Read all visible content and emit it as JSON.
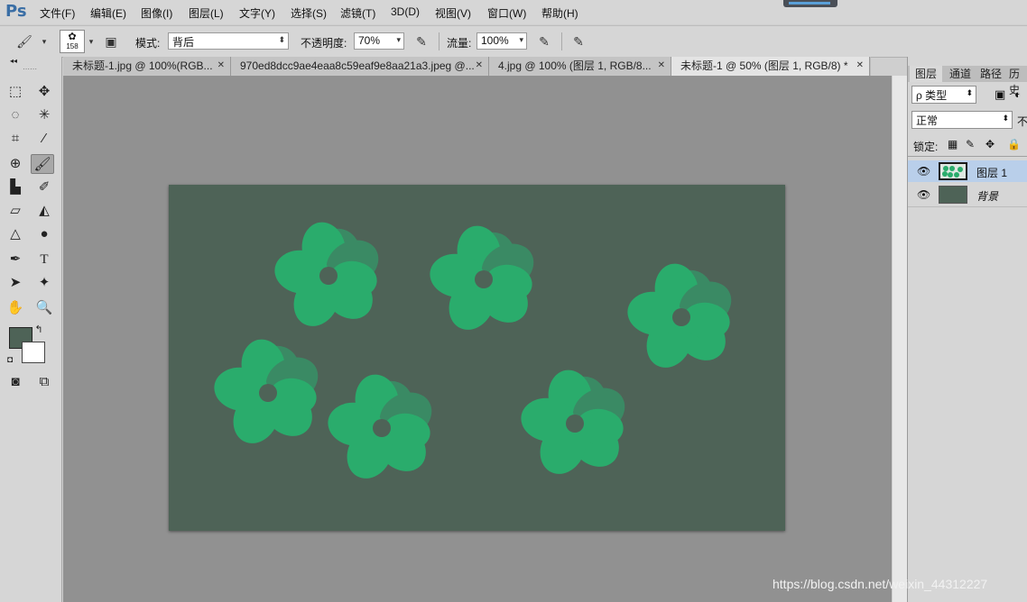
{
  "app": {
    "logo": "Ps",
    "menu": [
      "文件(F)",
      "编辑(E)",
      "图像(I)",
      "图层(L)",
      "文字(Y)",
      "选择(S)",
      "滤镜(T)",
      "3D(D)",
      "视图(V)",
      "窗口(W)",
      "帮助(H)"
    ]
  },
  "options": {
    "brush_size": "158",
    "mode_label": "模式:",
    "mode_value": "背后",
    "opacity_label": "不透明度:",
    "opacity_value": "70%",
    "flow_label": "流量:",
    "flow_value": "100%"
  },
  "tabs": [
    {
      "label": "未标题-1.jpg @ 100%(RGB..."
    },
    {
      "label": "970ed8dcc9ae4eaa8c59eaf9e8aa21a3.jpeg @..."
    },
    {
      "label": "4.jpg @ 100% (图层 1, RGB/8..."
    },
    {
      "label": "未标题-1 @ 50% (图层 1, RGB/8) *"
    }
  ],
  "colors": {
    "foreground": "#4e6357",
    "background": "#ffffff",
    "flower": "#2aac6c",
    "flower_shade": "#3a8a64"
  },
  "layers_panel": {
    "tabs": [
      "图层",
      "通道",
      "路径",
      "历史"
    ],
    "filter_label": "ρ 类型",
    "blend_mode": "正常",
    "opacity_prefix": "不",
    "lock_label": "锁定:",
    "layers": [
      {
        "name": "图层 1"
      },
      {
        "name": "背景"
      }
    ]
  },
  "watermark": "https://blog.csdn.net/weixin_44312227"
}
